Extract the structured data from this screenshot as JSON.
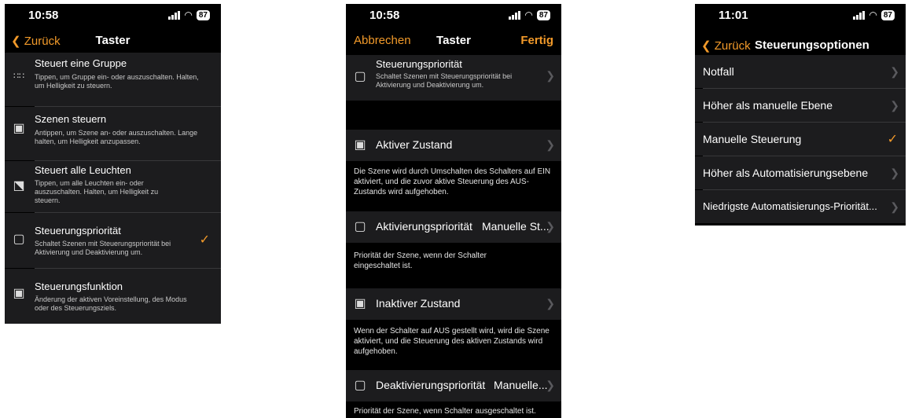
{
  "colors": {
    "accent": "#f29a2a",
    "background": "#000000",
    "cell": "#1c1c1e"
  },
  "left": {
    "status": {
      "time": "10:58",
      "battery": "87"
    },
    "nav": {
      "back": "Zurück",
      "title": "Taster"
    },
    "items": [
      {
        "icon": "group-icon",
        "title": "Steuert eine Gruppe",
        "desc": "Tippen, um Gruppe ein- oder auszuschalten. Halten, um Helligkeit zu steuern."
      },
      {
        "icon": "scene-icon",
        "title": "Szenen steuern",
        "desc": "Antippen, um Szene an- oder auszuschalten. Lange halten, um Helligkeit anzupassen."
      },
      {
        "icon": "all-lights-icon",
        "title": "Steuert alle Leuchten",
        "desc": "Tippen, um alle Leuchten ein- oder auszuschalten. Halten, um Helligkeit zu steuern."
      },
      {
        "icon": "priority-icon",
        "title": "Steuerungspriorität",
        "desc": "Schaltet Szenen mit Steuerungspriorität bei Aktivierung und Deaktivierung um."
      },
      {
        "icon": "function-icon",
        "title": "Steuerungsfunktion",
        "desc": "Änderung der aktiven Voreinstellung, des Modus oder des Steuerungsziels."
      }
    ]
  },
  "middle": {
    "status": {
      "time": "10:58",
      "battery": "87"
    },
    "nav": {
      "cancel": "Abbrechen",
      "title": "Taster",
      "done": "Fertig"
    },
    "top_item": {
      "title": "Steuerungspriorität",
      "desc": "Schaltet Szenen mit Steuerungspriorität bei Aktivierung und Deaktivierung um."
    },
    "active": {
      "label": "Aktiver Zustand",
      "footer": "Die Szene wird durch Umschalten des Schalters auf EIN aktiviert, und die zuvor aktive Steuerung des AUS-Zustands wird aufgehoben."
    },
    "activation_priority": {
      "label": "Aktivierungspriorität",
      "value": "Manuelle St...",
      "footer": "Priorität der Szene, wenn der Schalter eingeschaltet ist."
    },
    "inactive": {
      "label": "Inaktiver Zustand",
      "footer": "Wenn der Schalter auf AUS gestellt wird, wird die Szene aktiviert, und die Steuerung des aktiven Zustands wird aufgehoben."
    },
    "deactivation_priority": {
      "label": "Deaktivierungspriorität",
      "value": "Manuelle...",
      "footer": "Priorität der Szene, wenn Schalter ausgeschaltet ist."
    }
  },
  "right": {
    "status": {
      "time": "11:01",
      "battery": "87"
    },
    "nav": {
      "back": "Zurück",
      "title": "Steuerungsoptionen"
    },
    "options": [
      {
        "label": "Notfall"
      },
      {
        "label": "Höher als manuelle Ebene"
      },
      {
        "label": "Manuelle Steuerung"
      },
      {
        "label": "Höher als Automatisierungsebene"
      },
      {
        "label": "Niedrigste Automatisierungs-Priorität..."
      }
    ]
  }
}
